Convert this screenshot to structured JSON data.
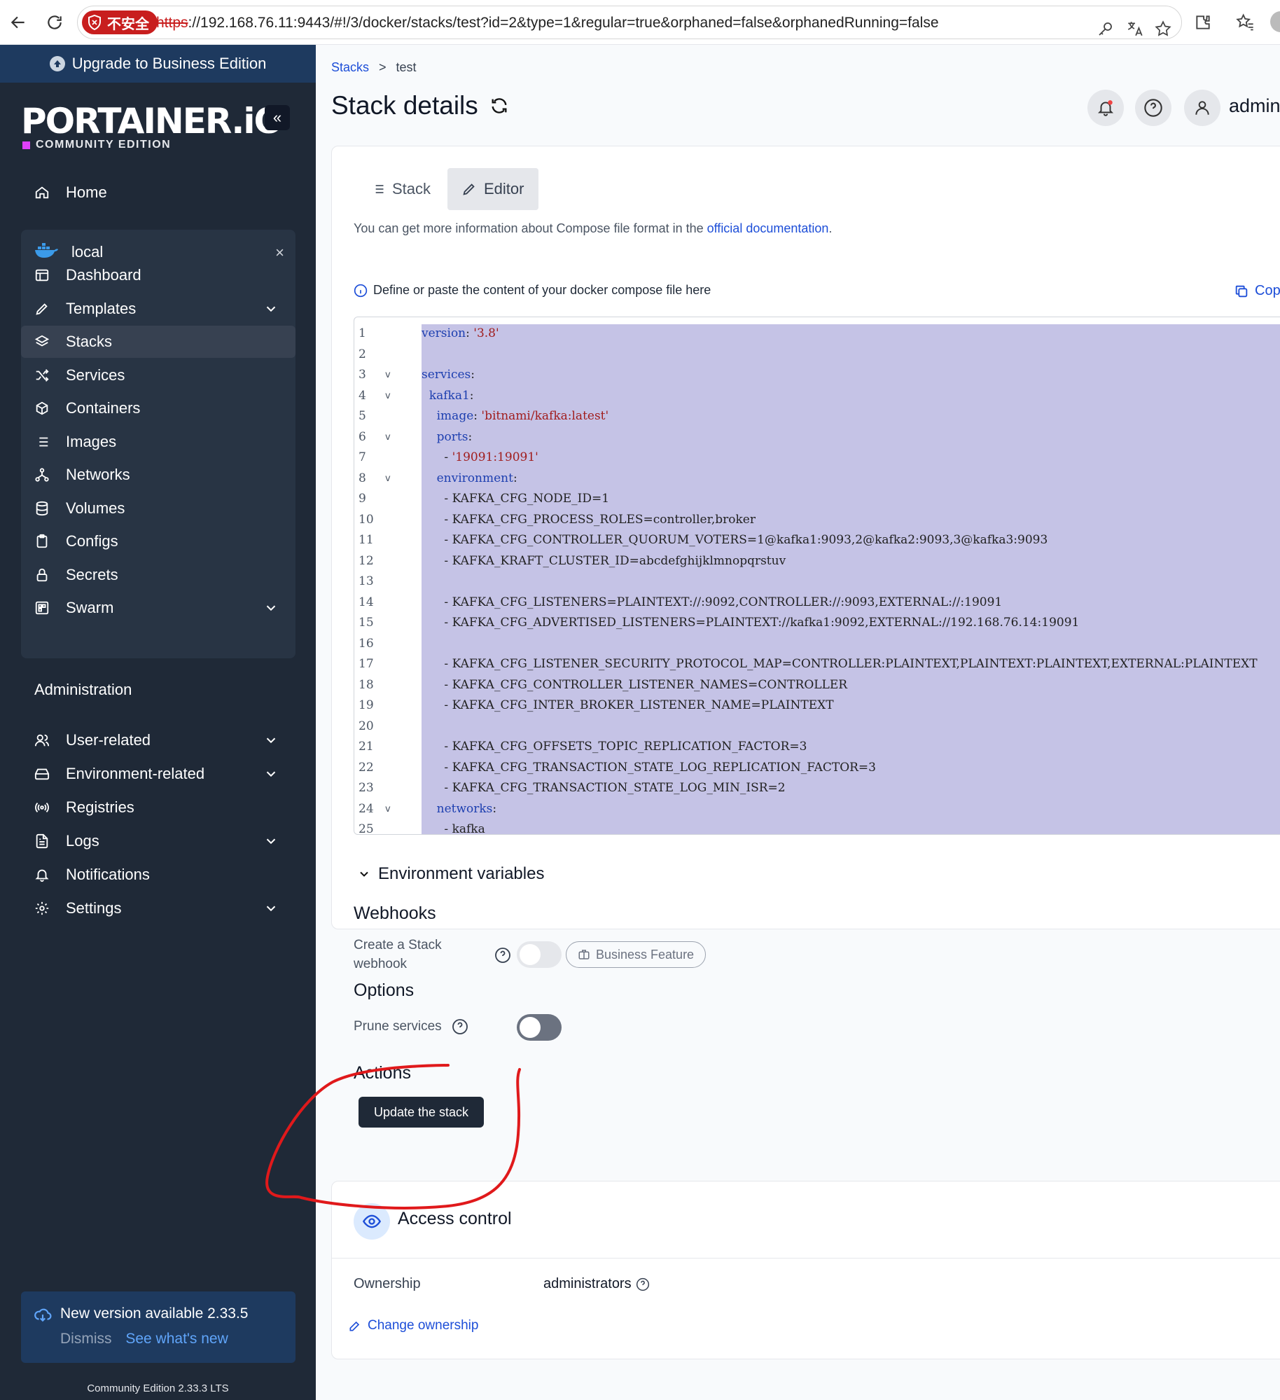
{
  "browser": {
    "insecure_label": "不安全",
    "url_protocol": "https",
    "url_rest": "://192.168.76.11:9443/#!/3/docker/stacks/test?id=2&type=1&regular=true&orphaned=false&orphanedRunning=false"
  },
  "sidebar": {
    "upgrade_label": "Upgrade to Business Edition",
    "logo_text": "PORTAINER.iO",
    "edition_text": "COMMUNITY EDITION",
    "collapse_glyph": "«",
    "home_label": "Home",
    "environment": {
      "name": "local",
      "close_glyph": "×",
      "items": [
        {
          "label": "Dashboard",
          "icon": "dashboard-icon"
        },
        {
          "label": "Templates",
          "icon": "edit-icon",
          "has_chevron": true
        },
        {
          "label": "Stacks",
          "icon": "layers-icon",
          "active": true
        },
        {
          "label": "Services",
          "icon": "shuffle-icon"
        },
        {
          "label": "Containers",
          "icon": "box-icon"
        },
        {
          "label": "Images",
          "icon": "list-icon"
        },
        {
          "label": "Networks",
          "icon": "network-icon"
        },
        {
          "label": "Volumes",
          "icon": "database-icon"
        },
        {
          "label": "Configs",
          "icon": "clipboard-icon"
        },
        {
          "label": "Secrets",
          "icon": "lock-icon"
        },
        {
          "label": "Swarm",
          "icon": "swarm-icon",
          "has_chevron": true
        }
      ]
    },
    "admin_title": "Administration",
    "admin_items": [
      {
        "label": "User-related",
        "icon": "users-icon",
        "has_chevron": true
      },
      {
        "label": "Environment-related",
        "icon": "hard-drive-icon",
        "has_chevron": true
      },
      {
        "label": "Registries",
        "icon": "radio-icon"
      },
      {
        "label": "Logs",
        "icon": "file-text-icon",
        "has_chevron": true
      },
      {
        "label": "Notifications",
        "icon": "bell-icon"
      },
      {
        "label": "Settings",
        "icon": "gear-icon",
        "has_chevron": true
      }
    ],
    "version_notice": {
      "title": "New version available 2.33.5",
      "dismiss": "Dismiss",
      "whats_new": "See what's new"
    },
    "footer": "Community Edition 2.33.3 LTS"
  },
  "main": {
    "breadcrumb": {
      "root": "Stacks",
      "separator": ">",
      "current": "test"
    },
    "title": "Stack details",
    "user": "admin",
    "tabs": {
      "stack": "Stack",
      "editor": "Editor"
    },
    "info_prefix": "You can get more information about Compose file format in the ",
    "info_link": "official documentation",
    "info_suffix": ".",
    "define_text": "Define or paste the content of your docker compose file here",
    "copy_label": "Cop",
    "code_lines": [
      {
        "n": "1",
        "fold": false,
        "indent": "",
        "key": "version",
        "sep": ": ",
        "str": "'3.8'"
      },
      {
        "n": "2",
        "fold": false,
        "indent": "",
        "key": "",
        "sep": "",
        "str": ""
      },
      {
        "n": "3",
        "fold": true,
        "indent": "",
        "key": "services",
        "sep": ":",
        "str": ""
      },
      {
        "n": "4",
        "fold": true,
        "indent": "  ",
        "key": "kafka1",
        "sep": ":",
        "str": ""
      },
      {
        "n": "5",
        "fold": false,
        "indent": "    ",
        "key": "image",
        "sep": ": ",
        "str": "'bitnami/kafka:latest'"
      },
      {
        "n": "6",
        "fold": true,
        "indent": "    ",
        "key": "ports",
        "sep": ":",
        "str": ""
      },
      {
        "n": "7",
        "fold": false,
        "indent": "      - ",
        "key": "",
        "sep": "",
        "str": "'19091:19091'"
      },
      {
        "n": "8",
        "fold": true,
        "indent": "    ",
        "key": "environment",
        "sep": ":",
        "str": ""
      },
      {
        "n": "9",
        "fold": false,
        "indent": "      - ",
        "plain": "KAFKA_CFG_NODE_ID=1"
      },
      {
        "n": "10",
        "fold": false,
        "indent": "      - ",
        "plain": "KAFKA_CFG_PROCESS_ROLES=controller,broker"
      },
      {
        "n": "11",
        "fold": false,
        "indent": "      - ",
        "plain": "KAFKA_CFG_CONTROLLER_QUORUM_VOTERS=1@kafka1:9093,2@kafka2:9093,3@kafka3:9093"
      },
      {
        "n": "12",
        "fold": false,
        "indent": "      - ",
        "plain": "KAFKA_KRAFT_CLUSTER_ID=abcdefghijklmnopqrstuv"
      },
      {
        "n": "13",
        "fold": false,
        "indent": "",
        "plain": ""
      },
      {
        "n": "14",
        "fold": false,
        "indent": "      - ",
        "plain": "KAFKA_CFG_LISTENERS=PLAINTEXT://:9092,CONTROLLER://:9093,EXTERNAL://:19091"
      },
      {
        "n": "15",
        "fold": false,
        "indent": "      - ",
        "plain": "KAFKA_CFG_ADVERTISED_LISTENERS=PLAINTEXT://kafka1:9092,EXTERNAL://192.168.76.14:19091"
      },
      {
        "n": "16",
        "fold": false,
        "indent": "",
        "plain": ""
      },
      {
        "n": "17",
        "fold": false,
        "indent": "      - ",
        "plain": "KAFKA_CFG_LISTENER_SECURITY_PROTOCOL_MAP=CONTROLLER:PLAINTEXT,PLAINTEXT:PLAINTEXT,EXTERNAL:PLAINTEXT"
      },
      {
        "n": "18",
        "fold": false,
        "indent": "      - ",
        "plain": "KAFKA_CFG_CONTROLLER_LISTENER_NAMES=CONTROLLER"
      },
      {
        "n": "19",
        "fold": false,
        "indent": "      - ",
        "plain": "KAFKA_CFG_INTER_BROKER_LISTENER_NAME=PLAINTEXT"
      },
      {
        "n": "20",
        "fold": false,
        "indent": "",
        "plain": ""
      },
      {
        "n": "21",
        "fold": false,
        "indent": "      - ",
        "plain": "KAFKA_CFG_OFFSETS_TOPIC_REPLICATION_FACTOR=3"
      },
      {
        "n": "22",
        "fold": false,
        "indent": "      - ",
        "plain": "KAFKA_CFG_TRANSACTION_STATE_LOG_REPLICATION_FACTOR=3"
      },
      {
        "n": "23",
        "fold": false,
        "indent": "      - ",
        "plain": "KAFKA_CFG_TRANSACTION_STATE_LOG_MIN_ISR=2"
      },
      {
        "n": "24",
        "fold": true,
        "indent": "    ",
        "key": "networks",
        "sep": ":",
        "str": ""
      },
      {
        "n": "25",
        "fold": false,
        "indent": "      - ",
        "plain": "kafka"
      }
    ],
    "env_vars_label": "Environment variables",
    "webhooks_title": "Webhooks",
    "webhook_label_1": "Create a Stack",
    "webhook_label_2": "webhook",
    "business_feature": "Business Feature",
    "options_title": "Options",
    "prune_label": "Prune services",
    "actions_title": "Actions",
    "update_button": "Update the stack",
    "access_control_title": "Access control",
    "ownership_label": "Ownership",
    "ownership_value": "administrators",
    "change_ownership": "Change ownership"
  },
  "colors": {
    "sidebar_bg": "#1f2937",
    "accent_blue": "#1d4ed8",
    "selection": "#c5c3e6",
    "annotation_red": "#e0191b"
  }
}
